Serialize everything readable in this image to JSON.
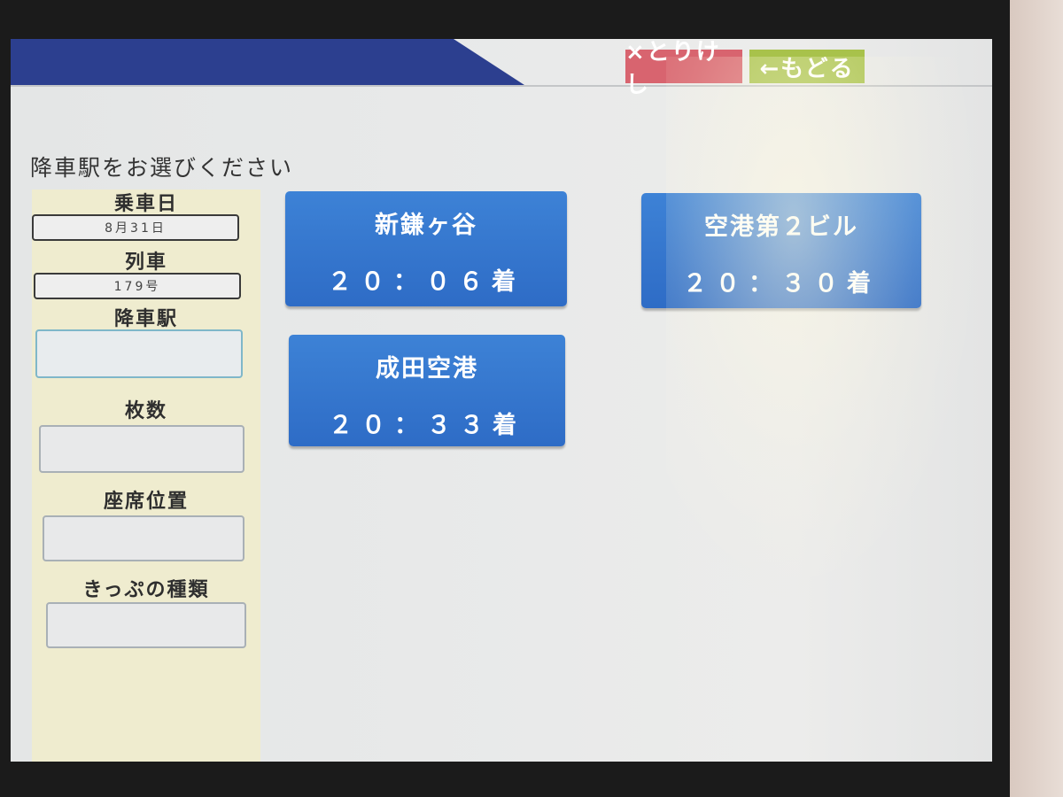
{
  "header": {
    "cancel_label": "×とりけし",
    "back_label": "←もどる"
  },
  "prompt": "降車駅をお選びください",
  "sidebar": {
    "boarding_date_label": "乗車日",
    "boarding_date_value": "8月31日",
    "train_label": "列車",
    "train_value": "179号",
    "arrival_station_label": "降車駅",
    "arrival_station_value": "",
    "ticket_count_label": "枚数",
    "ticket_count_value": "",
    "seat_position_label": "座席位置",
    "seat_position_value": "",
    "ticket_type_label": "きっぷの種類",
    "ticket_type_value": ""
  },
  "stations": [
    {
      "name": "新鎌ヶ谷",
      "time": "２０：０６着"
    },
    {
      "name": "空港第２ビル",
      "time": "２０：３０着"
    },
    {
      "name": "成田空港",
      "time": "２０：３３着"
    }
  ],
  "colors": {
    "header_blue": "#2c3f8f",
    "cancel_red": "#d8646f",
    "back_green": "#a8c24b",
    "station_blue": "#3d82d6",
    "sidebar_cream": "#efeccf"
  }
}
